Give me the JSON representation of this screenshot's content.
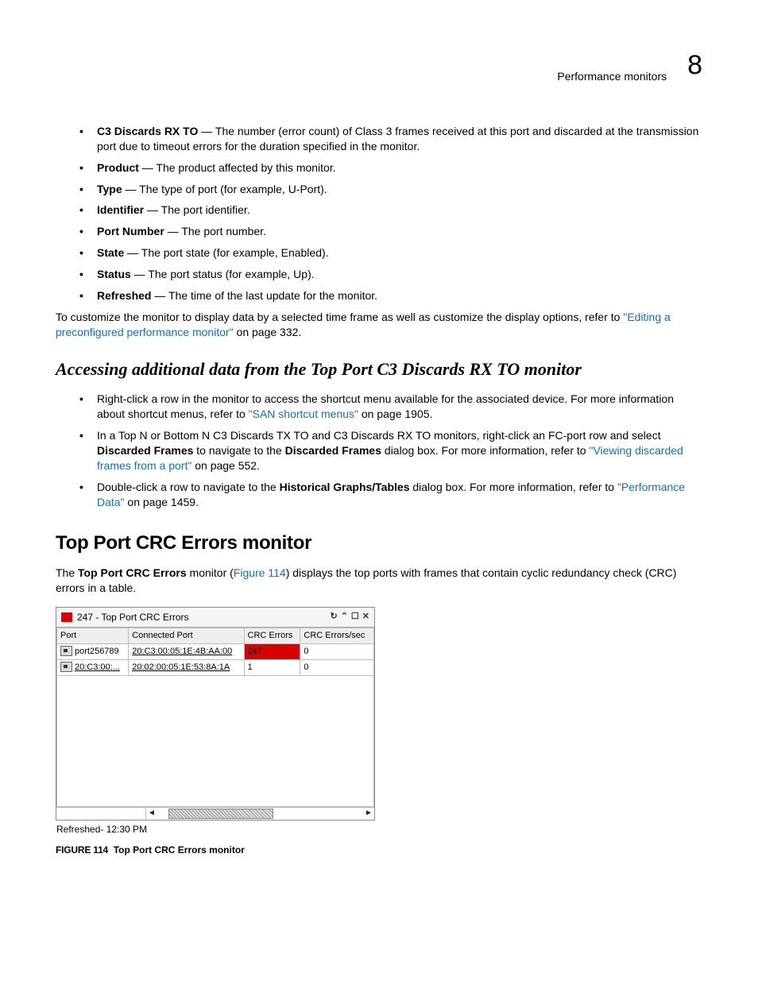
{
  "header": {
    "title": "Performance monitors",
    "chapnum": "8"
  },
  "bullets1": [
    {
      "term": "C3 Discards RX TO",
      "text": " — The number (error count) of Class 3 frames received at this port and discarded at the transmission port due to timeout errors for the duration specified in the monitor."
    },
    {
      "term": "Product",
      "text": " — The product affected by this monitor."
    },
    {
      "term": "Type",
      "text": " — The type of port (for example, U-Port)."
    },
    {
      "term": "Identifier",
      "text": " — The port identifier."
    },
    {
      "term": "Port Number",
      "text": " — The port number."
    },
    {
      "term": "State",
      "text": " — The port state (for example, Enabled)."
    },
    {
      "term": "Status",
      "text": " — The port status (for example, Up)."
    },
    {
      "term": "Refreshed",
      "text": " — The time of the last update for the monitor."
    }
  ],
  "afterBullets1_a": "To customize the monitor to display data by a selected time frame as well as customize the display options, refer to ",
  "afterBullets1_link": "\"Editing a preconfigured performance monitor\"",
  "afterBullets1_b": " on page 332.",
  "heading_access": "Accessing additional data from the Top Port C3 Discards RX TO monitor",
  "bullets2": {
    "b0_a": "Right-click a row in the monitor to access the shortcut menu available for the associated device. For more information about shortcut menus, refer to ",
    "b0_link": "\"SAN shortcut menus\"",
    "b0_b": " on page 1905.",
    "b1_a": "In a Top N or Bottom N C3 Discards TX TO and C3 Discards RX TO monitors, right-click an FC-port row and select ",
    "b1_bold1": "Discarded Frames",
    "b1_b": " to navigate to the ",
    "b1_bold2": "Discarded Frames",
    "b1_c": " dialog box. For more information, refer to ",
    "b1_link": "\"Viewing discarded frames from a port\"",
    "b1_d": " on page 552.",
    "b2_a": "Double-click a row to navigate to the ",
    "b2_bold": "Historical Graphs/Tables",
    "b2_b": " dialog box. For more information, refer to ",
    "b2_link": "\"Performance Data\"",
    "b2_c": " on page 1459."
  },
  "heading_top": "Top Port CRC Errors monitor",
  "top_para_a": "The ",
  "top_para_bold": "Top Port CRC Errors",
  "top_para_b": " monitor (",
  "top_para_link": "Figure 114",
  "top_para_c": ") displays the top ports with frames that contain cyclic redundancy check (CRC) errors in a table.",
  "monitor": {
    "title": "247 - Top Port CRC Errors",
    "cols": [
      "Port",
      "Connected Port",
      "CRC Errors",
      "CRC Errors/sec"
    ],
    "rows": [
      {
        "port": "port256789",
        "connected": "20:C3:00:05:1E:4B:AA:00",
        "errors": "247",
        "persec": "0",
        "hot": true
      },
      {
        "port": "20:C3:00:...",
        "connected": "20:02:00:05:1E:53:8A:1A",
        "errors": "1",
        "persec": "0",
        "hot": false
      }
    ],
    "refreshed": "Refreshed- 12:30 PM"
  },
  "figcap_num": "FIGURE 114",
  "figcap_text": "Top Port CRC Errors monitor"
}
